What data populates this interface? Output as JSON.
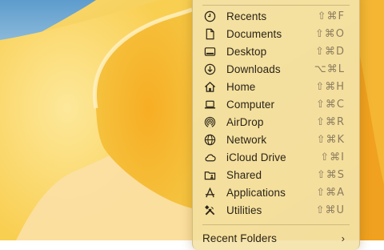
{
  "menu": {
    "items": [
      {
        "label": "Recents",
        "shortcut": "⇧⌘F",
        "icon": "clock-icon"
      },
      {
        "label": "Documents",
        "shortcut": "⇧⌘O",
        "icon": "document-icon"
      },
      {
        "label": "Desktop",
        "shortcut": "⇧⌘D",
        "icon": "desktop-icon"
      },
      {
        "label": "Downloads",
        "shortcut": "⌥⌘L",
        "icon": "download-icon"
      },
      {
        "label": "Home",
        "shortcut": "⇧⌘H",
        "icon": "home-icon"
      },
      {
        "label": "Computer",
        "shortcut": "⇧⌘C",
        "icon": "laptop-icon"
      },
      {
        "label": "AirDrop",
        "shortcut": "⇧⌘R",
        "icon": "airdrop-icon"
      },
      {
        "label": "Network",
        "shortcut": "⇧⌘K",
        "icon": "network-icon"
      },
      {
        "label": "iCloud Drive",
        "shortcut": "⇧⌘I",
        "icon": "cloud-icon"
      },
      {
        "label": "Shared",
        "shortcut": "⇧⌘S",
        "icon": "shared-folder-icon"
      },
      {
        "label": "Applications",
        "shortcut": "⇧⌘A",
        "icon": "applications-icon"
      },
      {
        "label": "Utilities",
        "shortcut": "⇧⌘U",
        "icon": "utilities-icon"
      }
    ],
    "recent_folders": {
      "label": "Recent Folders",
      "icon": "chevron-right-icon"
    }
  },
  "colors": {
    "wallpaper_light": "#fbe8a4",
    "wallpaper_mid": "#f8c23c",
    "wallpaper_dark": "#f0a020",
    "wallpaper_blue": "#6ea9d6",
    "menu_background": "#f4e2a8"
  }
}
